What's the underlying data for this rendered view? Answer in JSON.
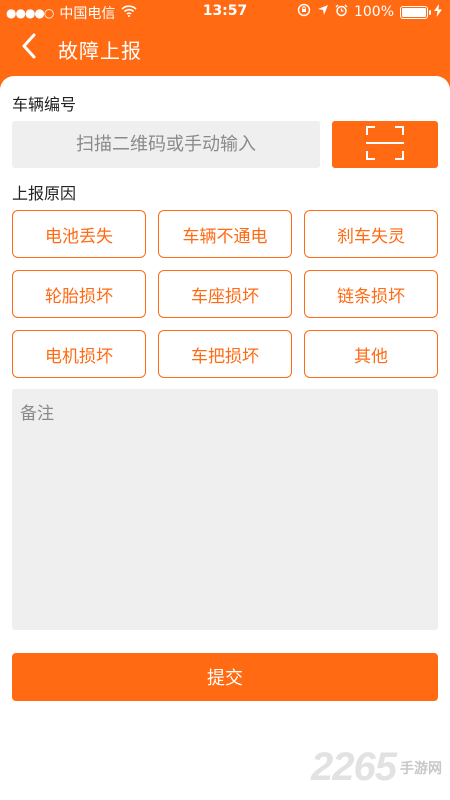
{
  "status_bar": {
    "signal": "●●●●○",
    "carrier": "中国电信",
    "time": "13:57",
    "battery_percent": "100%",
    "battery_level": 1.0
  },
  "nav": {
    "title": "故障上报",
    "back_icon": "chevron-left-icon"
  },
  "vehicle": {
    "label": "车辆编号",
    "placeholder": "扫描二维码或手动输入",
    "value": "",
    "scan_icon": "scan-icon"
  },
  "reason": {
    "label": "上报原因",
    "options": [
      "电池丢失",
      "车辆不通电",
      "刹车失灵",
      "轮胎损坏",
      "车座损坏",
      "链条损坏",
      "电机损坏",
      "车把损坏",
      "其他"
    ]
  },
  "remark": {
    "placeholder": "备注",
    "value": ""
  },
  "submit_label": "提交",
  "watermark": {
    "number": "2265",
    "text": "手游网"
  },
  "colors": {
    "accent": "#FF6A13",
    "input_bg": "#EFEFEF",
    "background": "#FFFFFF"
  }
}
